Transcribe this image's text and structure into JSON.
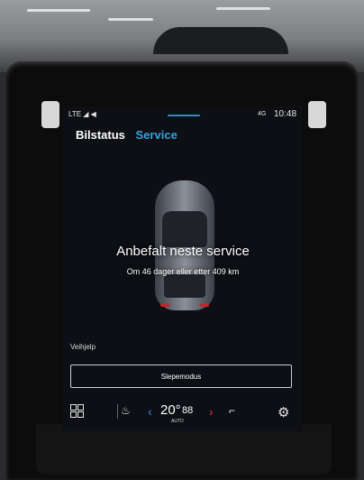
{
  "statusbar": {
    "left": "LTE ◢ ◀",
    "network": "4G",
    "time": "10:48"
  },
  "tabs": {
    "bilstatus": "Bilstatus",
    "service": "Service"
  },
  "service": {
    "headline": "Anbefalt neste service",
    "subtitle": "Om 46 dager eller etter 409 km"
  },
  "assist": {
    "heading": "Veihjelp",
    "button": "Slepemodus"
  },
  "climate": {
    "temperature": "20°",
    "fan": "88",
    "mode": "AUTO",
    "left_arrow": "‹",
    "right_arrow": "›"
  },
  "icons": {
    "apps": "grid-icon",
    "seat_left": "seat-heat-icon",
    "seat_right": "seat-icon",
    "settings": "gear-icon"
  },
  "colors": {
    "accent": "#34a4dc",
    "temp_down": "#3b8ae6",
    "temp_up": "#e2334a"
  }
}
